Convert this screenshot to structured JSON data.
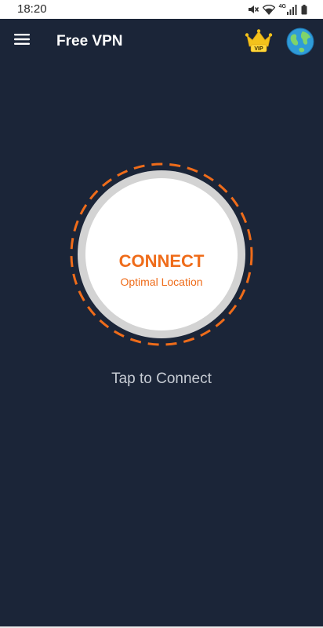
{
  "status_bar": {
    "time": "18:20",
    "network_label": "4G",
    "icons": [
      "mute-icon",
      "wifi-icon",
      "signal-icon",
      "battery-icon"
    ]
  },
  "app_bar": {
    "title": "Free VPN",
    "menu_icon": "hamburger-menu-icon",
    "vip_badge": "VIP",
    "vip_icon": "crown-icon",
    "location_icon": "globe-icon"
  },
  "connect": {
    "label": "CONNECT",
    "sublabel": "Optimal Location",
    "hint": "Tap to Connect"
  },
  "colors": {
    "background": "#1b2538",
    "accent": "#ef6c1a",
    "crown": "#f3c21b",
    "globe": "#2f9bd8",
    "hint_text": "#c7ccd4"
  }
}
